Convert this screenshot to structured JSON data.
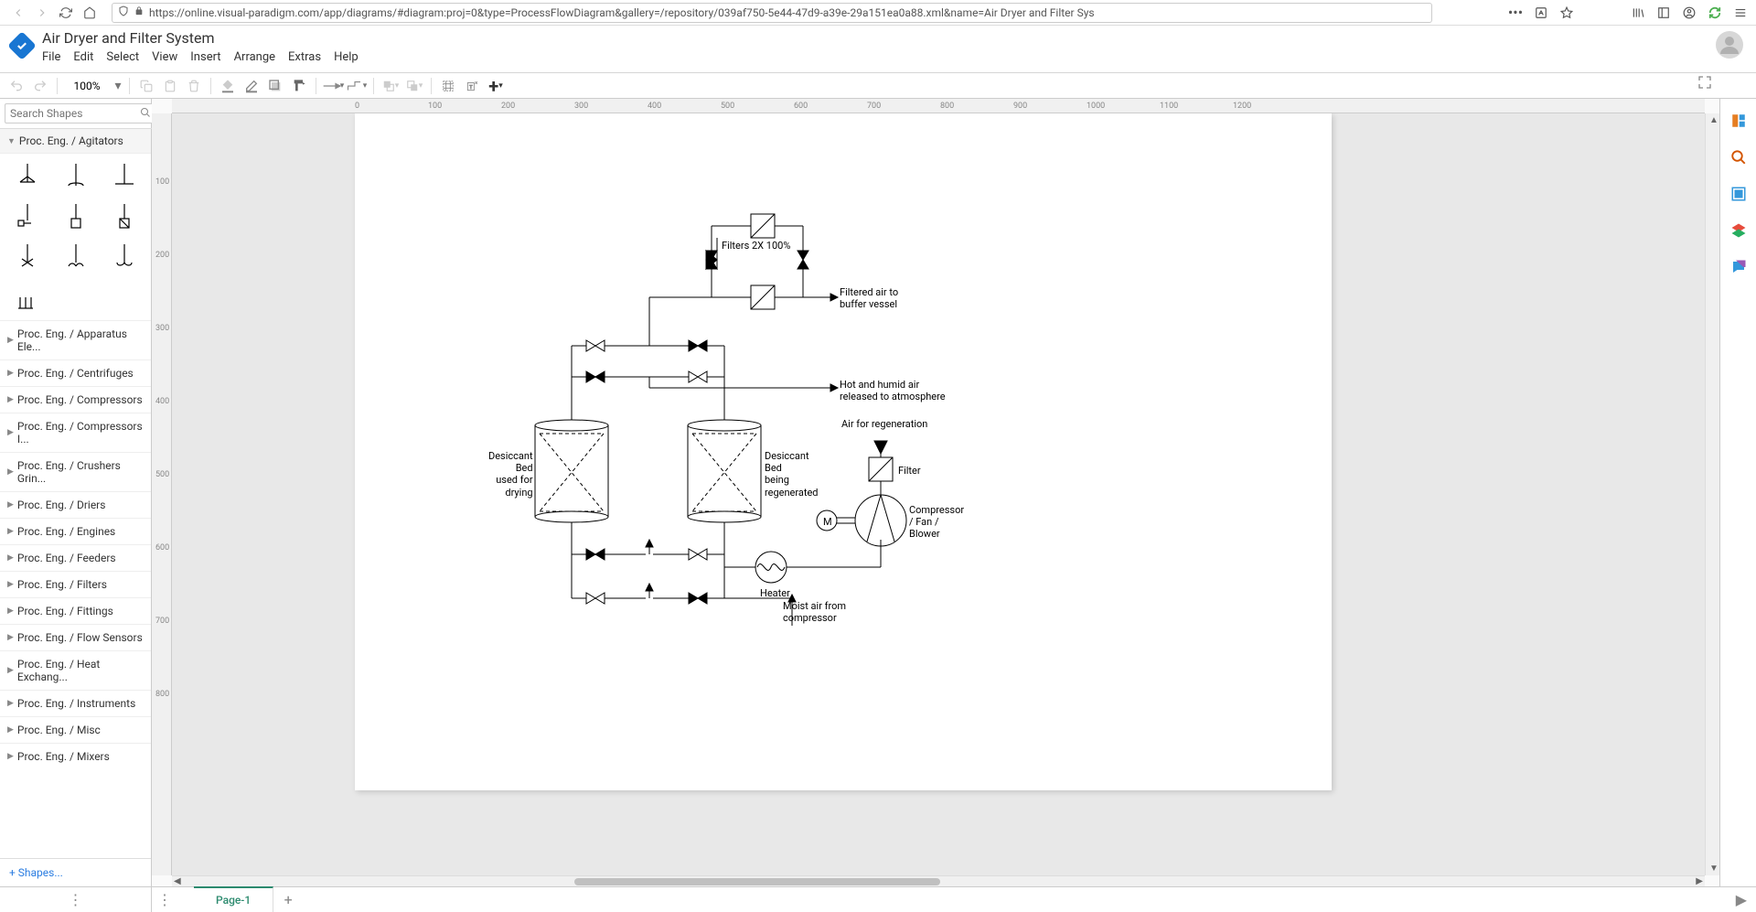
{
  "browser": {
    "url": "https://online.visual-paradigm.com/app/diagrams/#diagram:proj=0&type=ProcessFlowDiagram&gallery=/repository/039af750-5e44-47d9-a39e-29a151ea0a88.xml&name=Air Dryer and Filter Sys"
  },
  "app": {
    "title": "Air Dryer and Filter System",
    "menus": [
      "File",
      "Edit",
      "Select",
      "View",
      "Insert",
      "Arrange",
      "Extras",
      "Help"
    ]
  },
  "toolbar": {
    "zoom": "100%"
  },
  "shapesPanel": {
    "searchPlaceholder": "Search Shapes",
    "openSection": "Proc. Eng. / Agitators",
    "sections": [
      "Proc. Eng. / Apparatus Ele...",
      "Proc. Eng. / Centrifuges",
      "Proc. Eng. / Compressors",
      "Proc. Eng. / Compressors I...",
      "Proc. Eng. / Crushers Grin...",
      "Proc. Eng. / Driers",
      "Proc. Eng. / Engines",
      "Proc. Eng. / Feeders",
      "Proc. Eng. / Filters",
      "Proc. Eng. / Fittings",
      "Proc. Eng. / Flow Sensors",
      "Proc. Eng. / Heat Exchang...",
      "Proc. Eng. / Instruments",
      "Proc. Eng. / Misc",
      "Proc. Eng. / Mixers"
    ],
    "footerLink": "Shapes..."
  },
  "ruler": {
    "hTicks": [
      0,
      100,
      200,
      300,
      400,
      500,
      600,
      700,
      800,
      900,
      1000,
      1100,
      1200
    ],
    "vTicks": [
      100,
      200,
      300,
      400,
      500,
      600,
      700,
      800
    ]
  },
  "diagram": {
    "labels": {
      "filters2x": "Filters 2X 100%",
      "filteredAir": "Filtered air to\nbuffer vessel",
      "hotHumid": "Hot and humid air\nreleased to atmosphere",
      "airRegen": "Air for regeneration",
      "filter": "Filter",
      "compressor": "Compressor\n/ Fan /\nBlower",
      "m": "M",
      "heater": "Heater",
      "moistAir": "Moist air from\ncompressor",
      "bedDrying": "Desiccant\nBed\nused for\ndrying",
      "bedRegen": "Desiccant\nBed\nbeing\nregenerated"
    }
  },
  "tabs": {
    "page1": "Page-1"
  }
}
